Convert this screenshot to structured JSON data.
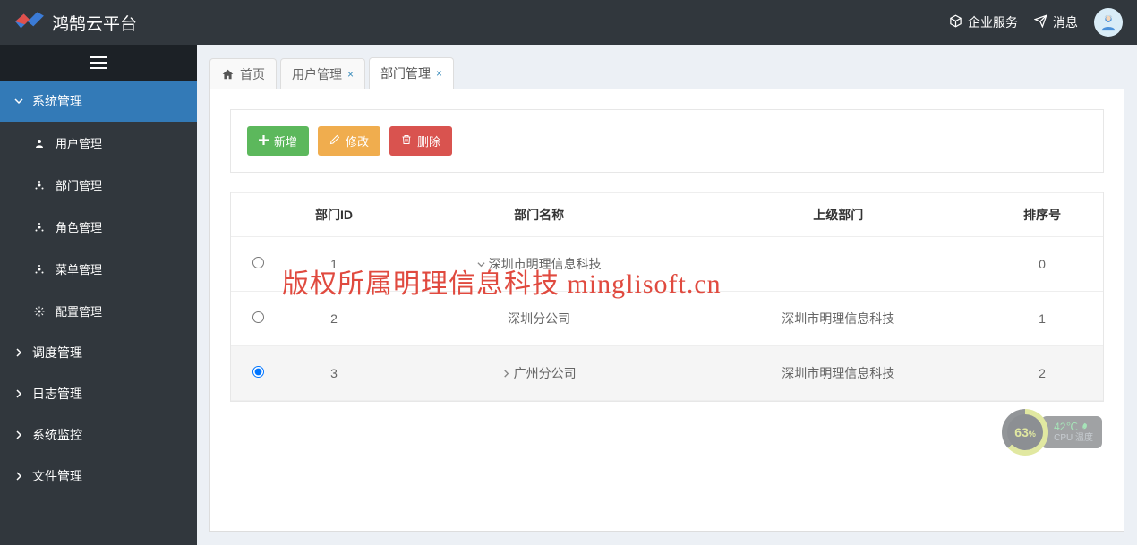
{
  "header": {
    "logo_text": "鸿鹄云平台",
    "enterprise_label": "企业服务",
    "message_label": "消息"
  },
  "sidebar": {
    "groups": [
      {
        "label": "系统管理",
        "expanded": true,
        "active": true,
        "children": [
          {
            "label": "用户管理"
          },
          {
            "label": "部门管理"
          },
          {
            "label": "角色管理"
          },
          {
            "label": "菜单管理"
          },
          {
            "label": "配置管理"
          }
        ]
      },
      {
        "label": "调度管理"
      },
      {
        "label": "日志管理"
      },
      {
        "label": "系统监控"
      },
      {
        "label": "文件管理"
      }
    ]
  },
  "tabs": [
    {
      "label": "首页",
      "home": true,
      "closable": false,
      "active": false
    },
    {
      "label": "用户管理",
      "closable": true,
      "active": false
    },
    {
      "label": "部门管理",
      "closable": true,
      "active": true
    }
  ],
  "toolbar": {
    "add_label": "新增",
    "edit_label": "修改",
    "delete_label": "删除"
  },
  "table": {
    "columns": {
      "id": "部门ID",
      "name": "部门名称",
      "parent": "上级部门",
      "order": "排序号"
    },
    "rows": [
      {
        "selected": false,
        "id": "1",
        "name": "深圳市明理信息科技",
        "expand": "down",
        "parent": "",
        "order": "0"
      },
      {
        "selected": false,
        "id": "2",
        "name": "深圳分公司",
        "expand": "",
        "parent": "深圳市明理信息科技",
        "order": "1"
      },
      {
        "selected": true,
        "id": "3",
        "name": "广州分公司",
        "expand": "right",
        "parent": "深圳市明理信息科技",
        "order": "2"
      }
    ]
  },
  "watermark": "版权所属明理信息科技 minglisoft.cn",
  "cpu_widget": {
    "percent": "63",
    "percent_suffix": "%",
    "temp": "42℃",
    "temp_label": "CPU 温度"
  }
}
